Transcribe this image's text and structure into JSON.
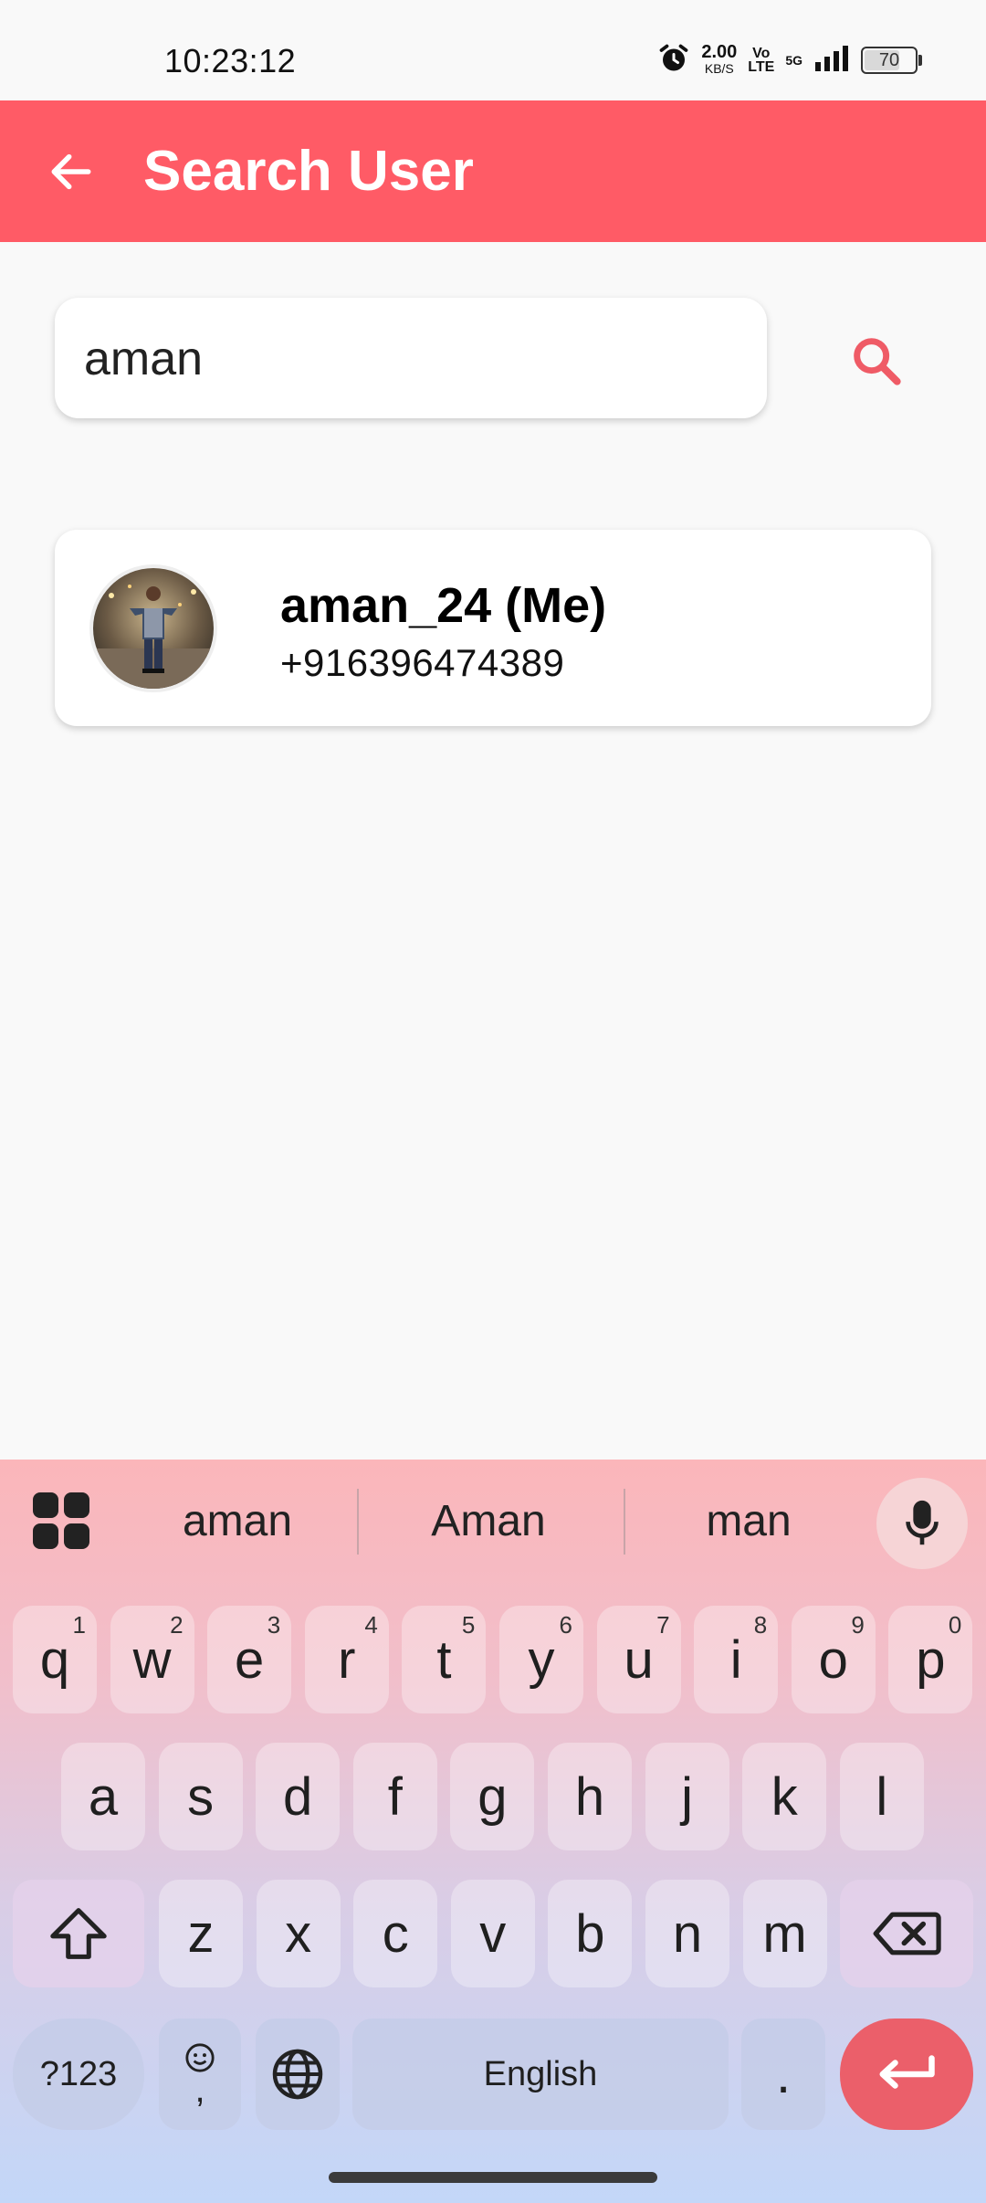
{
  "status_bar": {
    "time": "10:23:12",
    "speed_value": "2.00",
    "speed_unit": "KB/S",
    "volte_top": "Vo",
    "volte_bottom": "LTE",
    "network": "5G",
    "battery": "70",
    "battery_level": 0.7,
    "icons": [
      "alarm-icon",
      "signal-icon",
      "battery-icon"
    ]
  },
  "app_bar": {
    "title": "Search User",
    "back_icon": "back-arrow-icon",
    "color": "#ff5b66"
  },
  "search": {
    "value": "aman",
    "placeholder": "",
    "search_icon": "search-icon",
    "accent": "#ef5b66"
  },
  "results": [
    {
      "name": "aman_24 (Me)",
      "phone": "+916396474389",
      "avatar": "avatar-photo"
    }
  ],
  "keyboard": {
    "suggestions": [
      "aman",
      "Aman",
      "man"
    ],
    "row1": [
      {
        "key": "q",
        "hint": "1"
      },
      {
        "key": "w",
        "hint": "2"
      },
      {
        "key": "e",
        "hint": "3"
      },
      {
        "key": "r",
        "hint": "4"
      },
      {
        "key": "t",
        "hint": "5"
      },
      {
        "key": "y",
        "hint": "6"
      },
      {
        "key": "u",
        "hint": "7"
      },
      {
        "key": "i",
        "hint": "8"
      },
      {
        "key": "o",
        "hint": "9"
      },
      {
        "key": "p",
        "hint": "0"
      }
    ],
    "row2": [
      "a",
      "s",
      "d",
      "f",
      "g",
      "h",
      "j",
      "k",
      "l"
    ],
    "row3": [
      "z",
      "x",
      "c",
      "v",
      "b",
      "n",
      "m"
    ],
    "symbols_label": "?123",
    "comma_label": ",",
    "space_label": "English",
    "period_label": ".",
    "icons": [
      "apps-grid-icon",
      "microphone-icon",
      "shift-icon",
      "backspace-icon",
      "emoji-icon",
      "globe-icon",
      "enter-icon"
    ]
  }
}
